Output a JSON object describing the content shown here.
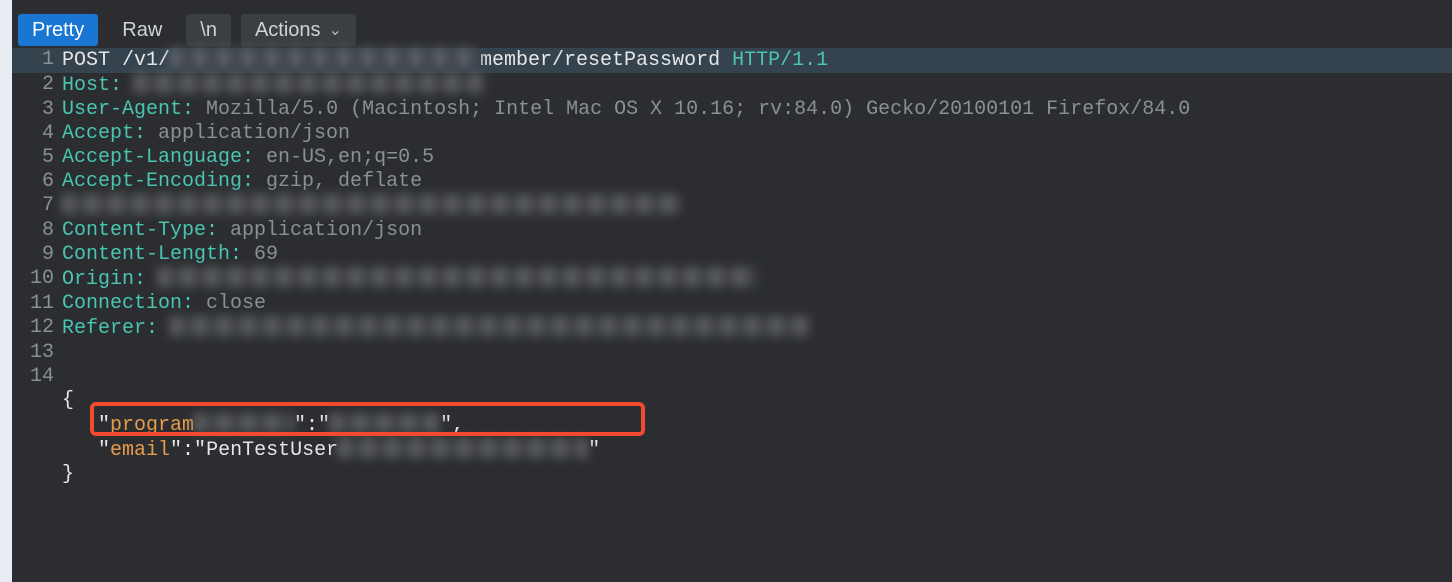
{
  "toolbar": {
    "pretty_label": "Pretty",
    "raw_label": "Raw",
    "newline_label": "\\n",
    "actions_label": "Actions"
  },
  "request": {
    "lines": {
      "1": {
        "method": "POST",
        "path_prefix": " /v1/",
        "path_suffix": "member/resetPassword ",
        "http_version": "HTTP/1.1"
      },
      "2": {
        "header_name": "Host",
        "colon": ": "
      },
      "3": {
        "header_name": "User-Agent",
        "colon": ": ",
        "header_value": "Mozilla/5.0 (Macintosh; Intel Mac OS X 10.16; rv:84.0) Gecko/20100101 Firefox/84.0"
      },
      "4": {
        "header_name": "Accept",
        "colon": ": ",
        "header_value": "application/json"
      },
      "5": {
        "header_name": "Accept-Language",
        "colon": ": ",
        "header_value": "en-US,en;q=0.5"
      },
      "6": {
        "header_name": "Accept-Encoding",
        "colon": ": ",
        "header_value": "gzip, deflate"
      },
      "7": {},
      "8": {
        "header_name": "Content-Type",
        "colon": ": ",
        "header_value": "application/json"
      },
      "9": {
        "header_name": "Content-Length",
        "colon": ": ",
        "header_value": "69"
      },
      "10": {
        "header_name": "Origin",
        "colon": ": "
      },
      "11": {
        "header_name": "Connection",
        "colon": ": ",
        "header_value": "close"
      },
      "12": {
        "header_name": "Referer",
        "colon": ": "
      },
      "13": {
        "blank": ""
      },
      "14": {
        "brace_open": "{"
      }
    },
    "body": {
      "indent": "   ",
      "line1": {
        "q1": "\"",
        "key_prefix": "program",
        "middle": "\":\"",
        "end": "\","
      },
      "line2": {
        "q1": "\"",
        "key": "email",
        "middle": "\":\"",
        "value_prefix": "PenTestUser",
        "q_end": "\""
      },
      "brace_close": "}"
    }
  }
}
